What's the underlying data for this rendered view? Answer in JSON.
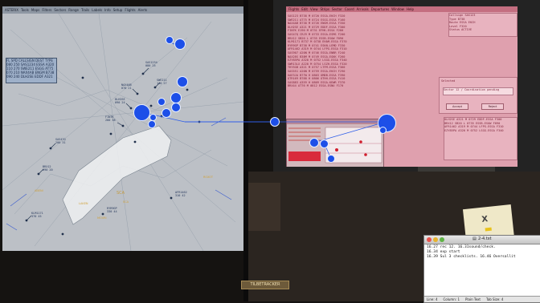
{
  "radar_screen": {
    "menu": [
      "ASTERIX",
      "Tools",
      "Maps",
      "Filters",
      "Sectors",
      "Range",
      "Trails",
      "Labels",
      "Info",
      "Setup",
      "Flights",
      "Alerts"
    ],
    "info_table_rows": [
      "FL   SPD  CALLSIGN  DEST   TYPE",
      "080  250  SAS1234   ESSA   A320",
      "110  270  SWE211    ESGG   AT75",
      "070  210  NAX4AB    ENGM   B738",
      "090  240  DLH2SE    EDDF   A321"
    ],
    "sector_label": "SCA"
  },
  "strip_screen": {
    "menu": [
      "Flights",
      "Edit",
      "View",
      "Strips",
      "Sector",
      "Coord",
      "Arrivals",
      "Departures",
      "Window",
      "Help"
    ],
    "strip_rows": [
      "SAS123  B738  M  0720  ESSA-EKCH   F320",
      "SWE211  AT75  M  0724  ESGG-ESSA   F160",
      "NAX4AB  B738  M  0726  ENGM-ESSA   F350",
      "DLH2SE  A321  M  0729  EDDF-ESSA   F300",
      "FIN7K   E190  M  0731  EFHK-ESSA   F280",
      "SAS47Q  CRJ9  M  0733  ESSA-ESMS   F200",
      "BRX12   SB20  L  0735  ESSB-ESOW   F090",
      "KLM1171 B737  M  0738  EHAM-ESSA   F370",
      "RYR9GP  B738  M  0741  ESKN-LEMD   F330",
      "AFR1462 A319  M  0744  LFPG-ESSA   F310",
      "SAS907  A20N  M  0746  ESSA-ENBR   F240",
      "NAX28S  B38M  M  0749  ESSA-EGKK   F260",
      "EZY85PA A320  M  0752  LSGG-ESSA   F340",
      "SWR13LX A220  M  0754  LSZH-ESSA   F320",
      "THY5GB  A321  M  0757  LTFM-ESSA   F360",
      "SAS551  A20N  M  0759  ESSA-EKCH   F290",
      "UAE3JA  B77W  H  0803  OMDB-ESSA   F390",
      "QTR169  B788  H  0806  OTHH-ESSA   F410",
      "SAS883  A359  H  0809  ESSA-KEWR   F370",
      "BRX44   AT76  M  0812  ESSA-ESNU   F170"
    ],
    "dialog_buttons": [
      "Accept",
      "Reject"
    ],
    "right_panel_rows": [
      "Callsign   SAS123",
      "Type       B738",
      "Route      ESSA EKCH",
      "Level      F320",
      "Status     ACTIVE"
    ],
    "lower_panel_title": "Selected",
    "lower_panel_text": "Sector 12 / Coordination pending"
  },
  "editor": {
    "filename": "2-4.txt",
    "lines": [
      "16.27 rec 12. 16.31sound/check.",
      "16.34 exp start",
      "16.39 Sul 3 checklists. 16.46 Oversallit"
    ],
    "status": {
      "line": "Line: 4",
      "column": "Column: 1",
      "format": "Plain Text",
      "tab": "Tab Size: 4"
    }
  },
  "desk": {
    "brand_label": "TILBETRACKER",
    "note_mark": "X"
  },
  "colors": {
    "radar_bg": "#bcc0c6",
    "strip_bg": "#dfa0ae",
    "gaze_blue": "#1d4fe8"
  }
}
